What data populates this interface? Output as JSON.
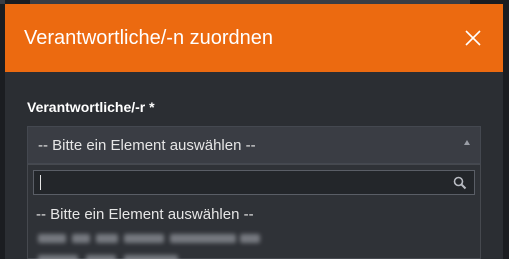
{
  "dialog": {
    "title": "Verantwortliche/-n zuordnen",
    "close_icon": "close-icon",
    "header_color": "#ec6a10"
  },
  "form": {
    "field_label": "Verantwortliche/-r *",
    "select": {
      "selected_value": "-- Bitte ein Element auswählen --",
      "arrow_icon": "caret-up-icon"
    },
    "dropdown": {
      "search_value": "",
      "search_icon": "search-icon",
      "options": [
        {
          "label": "-- Bitte ein Element auswählen --"
        }
      ]
    }
  }
}
